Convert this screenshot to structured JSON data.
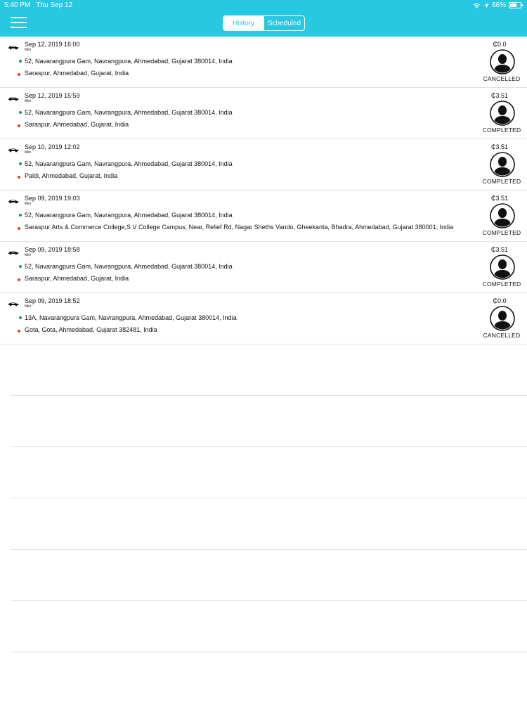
{
  "status_bar": {
    "time": "5:40 PM",
    "date": "Thu Sep 12",
    "battery": "66%",
    "battery_level": 0.66
  },
  "header": {
    "menu_icon": "hamburger-menu-icon",
    "tabs": [
      {
        "label": "History",
        "active": true
      },
      {
        "label": "Scheduled",
        "active": false
      }
    ],
    "accent_color": "#29c8e2"
  },
  "rides": [
    {
      "datetime": "Sep 12, 2019 16:00",
      "vehicle": "Mini",
      "pickup": "52, Navarangpura Gam, Navrangpura, Ahmedabad, Gujarat 380014, India",
      "drop": "Saraspur, Ahmedabad, Gujarat, India",
      "fare": "₵0.0",
      "status": "CANCELLED"
    },
    {
      "datetime": "Sep 12, 2019 15:59",
      "vehicle": "Mini",
      "pickup": "52, Navarangpura Gam, Navrangpura, Ahmedabad, Gujarat 380014, India",
      "drop": "Saraspur, Ahmedabad, Gujarat, India",
      "fare": "₵3.51",
      "status": "COMPLETED"
    },
    {
      "datetime": "Sep 10, 2019 12:02",
      "vehicle": "Mini",
      "pickup": "52, Navarangpura Gam, Navrangpura, Ahmedabad, Gujarat 380014, India",
      "drop": "Paldi, Ahmedabad, Gujarat, India",
      "fare": "₵3.51",
      "status": "COMPLETED"
    },
    {
      "datetime": "Sep 09, 2019 19:03",
      "vehicle": "Mini",
      "pickup": "52, Navarangpura Gam, Navrangpura, Ahmedabad, Gujarat 380014, India",
      "drop": "Saraspur Arts & Commerce College,S V College Campus, Near, Relief Rd, Nagar Sheths Vando, Gheekanta, Bhadra, Ahmedabad, Gujarat 380001, India",
      "fare": "₵3.51",
      "status": "COMPLETED"
    },
    {
      "datetime": "Sep 09, 2019 18:58",
      "vehicle": "Mini",
      "pickup": "52, Navarangpura Gam, Navrangpura, Ahmedabad, Gujarat 380014, India",
      "drop": "Saraspur, Ahmedabad, Gujarat, India",
      "fare": "₵3.51",
      "status": "COMPLETED"
    },
    {
      "datetime": "Sep 09, 2019 18:52",
      "vehicle": "Mini",
      "pickup": "13A, Navarangpura Gam, Navrangpura, Ahmedabad, Gujarat 380014, India",
      "drop": "Gota, Gota, Ahmedabad, Gujarat 382481, India",
      "fare": "₵0.0",
      "status": "CANCELLED"
    }
  ],
  "colors": {
    "pickup_dot": "#1a9b52",
    "drop_dot": "#e53935"
  }
}
